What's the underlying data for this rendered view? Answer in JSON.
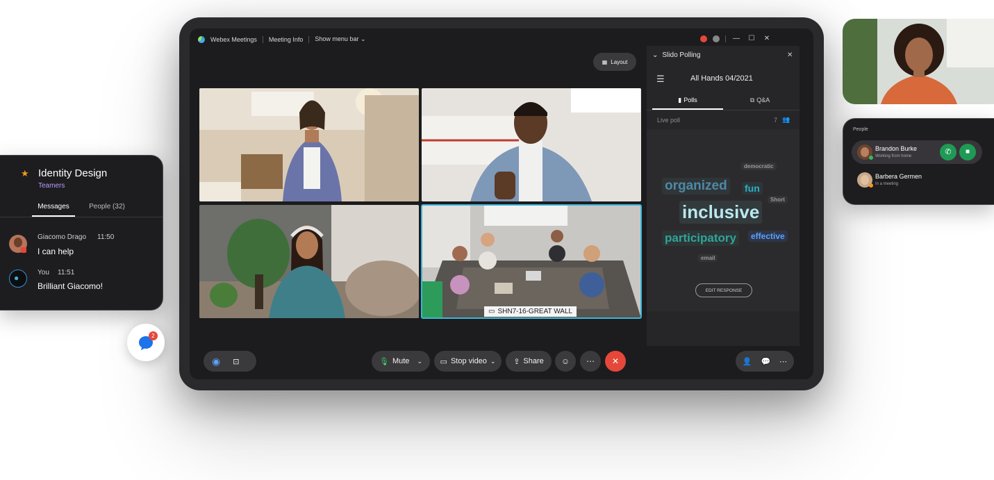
{
  "titlebar": {
    "app_name": "Webex Meetings",
    "meeting_info": "Meeting Info",
    "show_menu_bar": "Show menu bar"
  },
  "layout_button": "Layout",
  "video": {
    "room_label": "SHN7-16-GREAT WALL"
  },
  "controls": {
    "mute": "Mute",
    "stop_video": "Stop video",
    "share": "Share",
    "more": "⋯"
  },
  "slido": {
    "title": "Slido Polling",
    "event_name": "All Hands 04/2021",
    "tab_polls": "Polls",
    "tab_qa": "Q&A",
    "live_poll_label": "Live poll",
    "participant_count": "7",
    "words": [
      {
        "text": "democratic",
        "color": "#9a9a9a"
      },
      {
        "text": "organized",
        "color": "#4d8aa6"
      },
      {
        "text": "fun",
        "color": "#2ab3c4"
      },
      {
        "text": "Short",
        "color": "#9a9a9a"
      },
      {
        "text": "inclusive",
        "color": "#b9e7ef"
      },
      {
        "text": "participatory",
        "color": "#2fa59a"
      },
      {
        "text": "effective",
        "color": "#5aa2ff"
      },
      {
        "text": "email",
        "color": "#9a9a9a"
      }
    ],
    "edit_response": "EDIT RESPONSE"
  },
  "chat_card": {
    "space_name": "Identity Design",
    "team_name": "Teamers",
    "tab_messages": "Messages",
    "tab_people": "People (32)",
    "messages": [
      {
        "sender": "Giacomo Drago",
        "time": "11:50",
        "text": "I can help"
      },
      {
        "sender": "You",
        "time": "11:51",
        "text": "Brilliant Giacomo!"
      }
    ]
  },
  "chat_bubble": {
    "badge_count": "2"
  },
  "people_card": {
    "title": "People",
    "people": [
      {
        "name": "Brandon Burke",
        "status": "Working from home"
      },
      {
        "name": "Barbera Germen",
        "status": "In a meeting"
      }
    ]
  },
  "colors": {
    "accent_teal": "#3db4d6",
    "end_call_red": "#e5483a",
    "call_green": "#1f9a55",
    "team_purple": "#b99cff",
    "star_orange": "#f29a1f"
  }
}
